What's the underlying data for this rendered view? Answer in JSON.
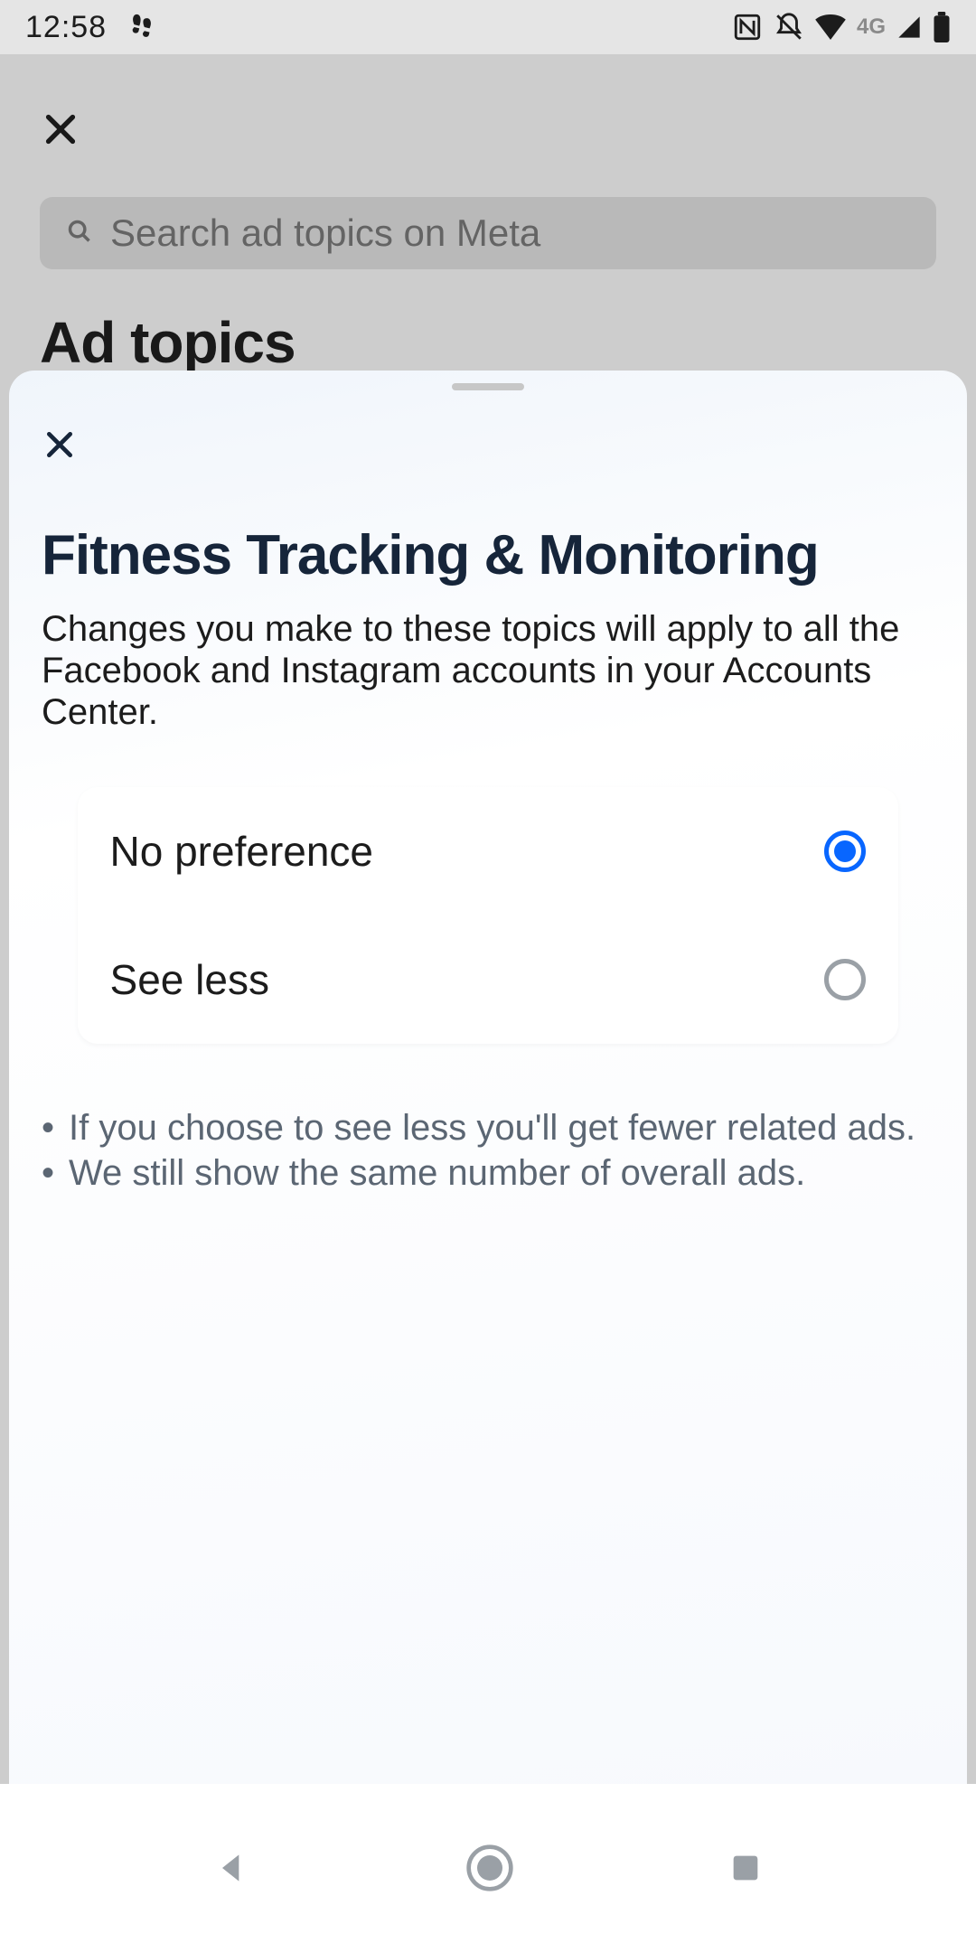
{
  "status": {
    "time": "12:58",
    "network_label": "4G"
  },
  "background": {
    "search_placeholder": "Search ad topics on Meta",
    "title": "Ad topics"
  },
  "sheet": {
    "title": "Fitness Tracking & Monitoring",
    "description": "Changes you make to these topics will apply to all the Facebook and Instagram accounts in your Accounts Center.",
    "options": [
      {
        "label": "No preference",
        "selected": true
      },
      {
        "label": "See less",
        "selected": false
      }
    ],
    "notes": [
      "If you choose to see less you'll get fewer related ads.",
      "We still show the same number of overall ads."
    ]
  }
}
